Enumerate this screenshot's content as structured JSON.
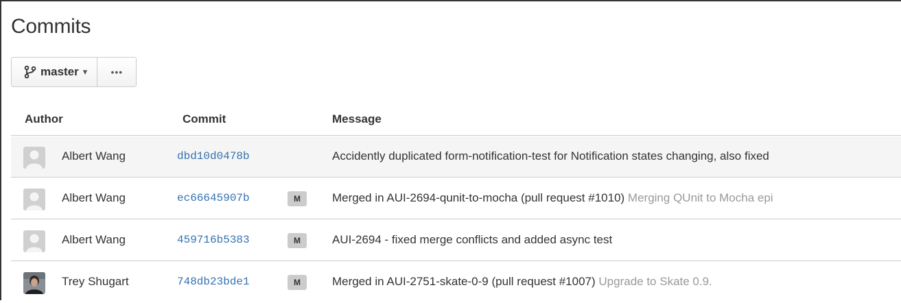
{
  "page": {
    "title": "Commits"
  },
  "toolbar": {
    "branch_icon": "branch-icon",
    "branch_label": "master",
    "branch_caret": "▾",
    "more_label": "•••"
  },
  "table": {
    "headers": {
      "author": "Author",
      "commit": "Commit",
      "message": "Message"
    },
    "rows": [
      {
        "author": "Albert Wang",
        "avatar": "default-avatar-icon",
        "commit": "dbd10d0478b",
        "merge": "",
        "message": "Accidently duplicated form-notification-test for Notification states changing, also fixed",
        "message_detail": ""
      },
      {
        "author": "Albert Wang",
        "avatar": "default-avatar-icon",
        "commit": "ec66645907b",
        "merge": "M",
        "message": "Merged in AUI-2694-qunit-to-mocha (pull request #1010)",
        "message_detail": "Merging QUnit to Mocha epi"
      },
      {
        "author": "Albert Wang",
        "avatar": "default-avatar-icon",
        "commit": "459716b5383",
        "merge": "M",
        "message": "AUI-2694 - fixed merge conflicts and added async test",
        "message_detail": ""
      },
      {
        "author": "Trey Shugart",
        "avatar": "user-photo-avatar",
        "commit": "748db23bde1",
        "merge": "M",
        "message": "Merged in AUI-2751-skate-0-9 (pull request #1007)",
        "message_detail": "Upgrade to Skate 0.9."
      }
    ]
  },
  "colors": {
    "link": "#3572b0",
    "row_highlight": "#f5f5f5",
    "muted": "#999999",
    "badge_bg": "#cccccc"
  }
}
